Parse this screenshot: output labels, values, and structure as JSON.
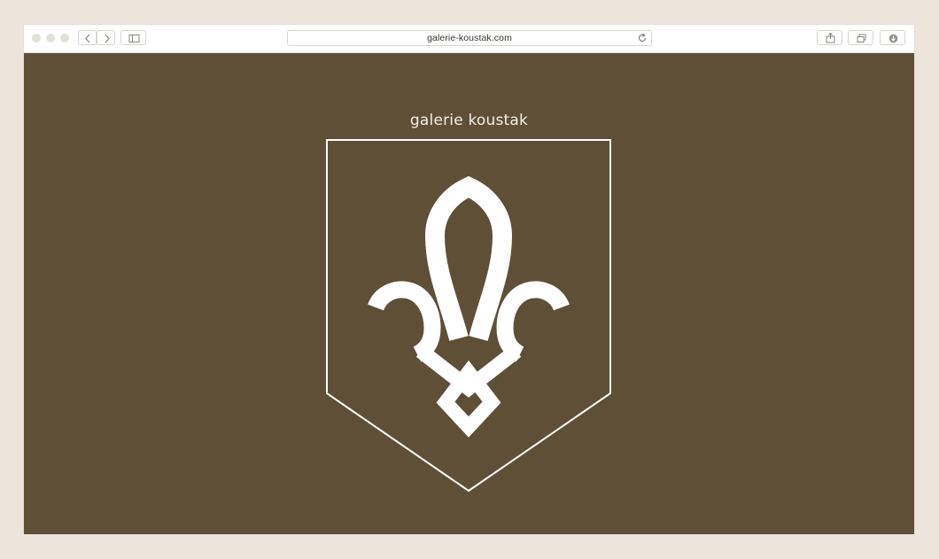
{
  "browser": {
    "address_bar": {
      "url": "galerie-koustak.com"
    },
    "window_controls": [
      "close",
      "minimize",
      "zoom"
    ],
    "nav_icons": {
      "back": "chevron-left-icon",
      "forward": "chevron-right-icon",
      "sidebar": "sidebar-icon",
      "reload": "reload-icon",
      "share": "share-icon",
      "tabs": "tabs-icon",
      "downloads": "download-icon"
    }
  },
  "page": {
    "brand_name": "galerie koustak",
    "logo_icon": "fleur-de-lis-icon",
    "colors": {
      "background": "#5f4f37",
      "foreground": "#ffffff",
      "page_surround": "#ede5dc"
    }
  }
}
